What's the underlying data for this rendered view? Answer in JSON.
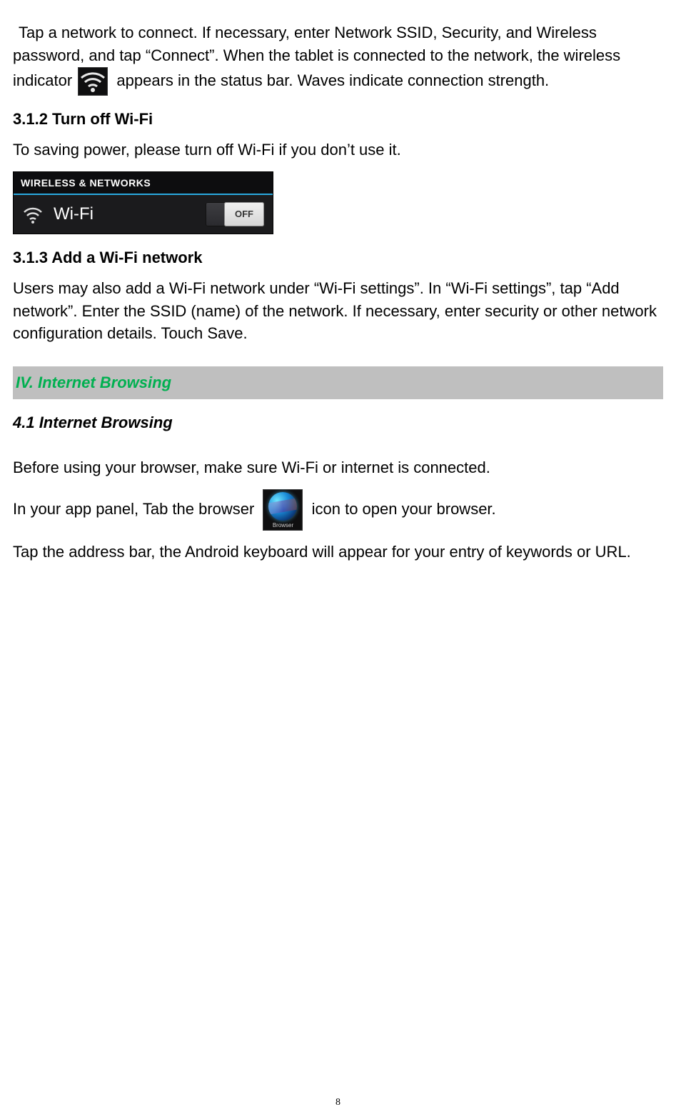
{
  "paragraphs": {
    "p1a": " Tap a network to connect. If necessary, enter Network SSID, Security, and Wireless password, and tap “Connect”. When the tablet is connected to the network, the wireless indicator ",
    "p1b": " appears in the status bar. Waves indicate connection strength.",
    "p2": "To saving power, please turn off Wi-Fi if you don’t use it.",
    "p3": "Users may also add a Wi-Fi network under “Wi-Fi settings”. In “Wi-Fi settings”, tap “Add network”. Enter the SSID (name) of the network. If necessary, enter security or other network configuration details. Touch Save.",
    "p4": "Before using your browser, make sure Wi-Fi or internet is connected.",
    "p5a": "In your app panel, Tab the browser ",
    "p5b": " icon to open your browser.",
    "p6": "Tap the address bar, the Android keyboard will appear for your entry of keywords or URL."
  },
  "headings": {
    "h1": "3.1.2 Turn off Wi-Fi",
    "h2": "3.1.3 Add a Wi-Fi network",
    "section": "IV. Internet Browsing",
    "h3": "4.1 Internet Browsing"
  },
  "wifi_panel": {
    "header": "WIRELESS & NETWORKS",
    "label": "Wi-Fi",
    "toggle": "OFF"
  },
  "browser_icon_label": "Browser",
  "page_number": "8"
}
